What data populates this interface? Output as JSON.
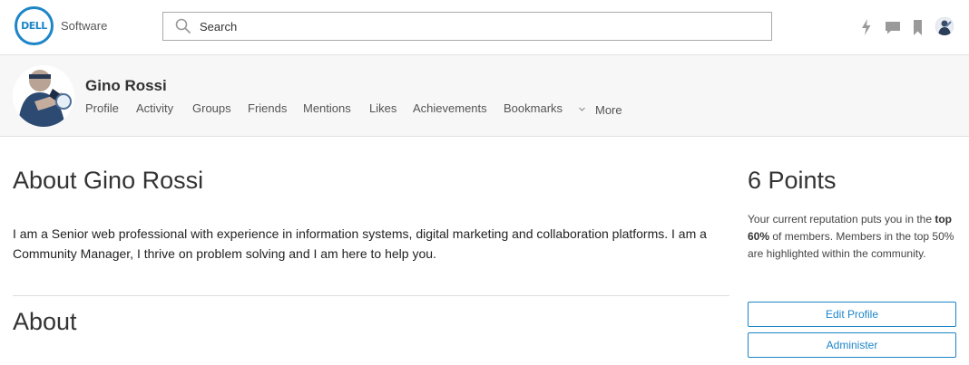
{
  "header": {
    "logo_text": "DELL",
    "brand": "Software",
    "search": {
      "placeholder": "Search",
      "icon": "search-icon"
    },
    "icons": [
      "lightning-icon",
      "chat-bubble-icon",
      "bookmark-icon",
      "user-avatar"
    ]
  },
  "profile": {
    "name": "Gino Rossi",
    "tabs": [
      "Profile",
      "Activity",
      "Groups",
      "Friends",
      "Mentions",
      "Likes",
      "Achievements",
      "Bookmarks"
    ],
    "more_label": "More"
  },
  "main": {
    "about_title": "About Gino Rossi",
    "bio": "I am a Senior web professional with experience in information systems, digital marketing and collaboration platforms.  I am a Community Manager, I thrive on problem solving and I am here to help you.",
    "section_title": "About"
  },
  "sidebar": {
    "points_title": "6 Points",
    "rep_text_1": "Your current reputation puts you in the ",
    "rep_bold": "top 60%",
    "rep_text_2": " of members. Members in the top 50% are highlighted within the community.",
    "edit_button": "Edit Profile",
    "admin_button": "Administer"
  },
  "colors": {
    "accent": "#1d85c8",
    "header_bg": "#f7f7f7",
    "text": "#333333"
  }
}
